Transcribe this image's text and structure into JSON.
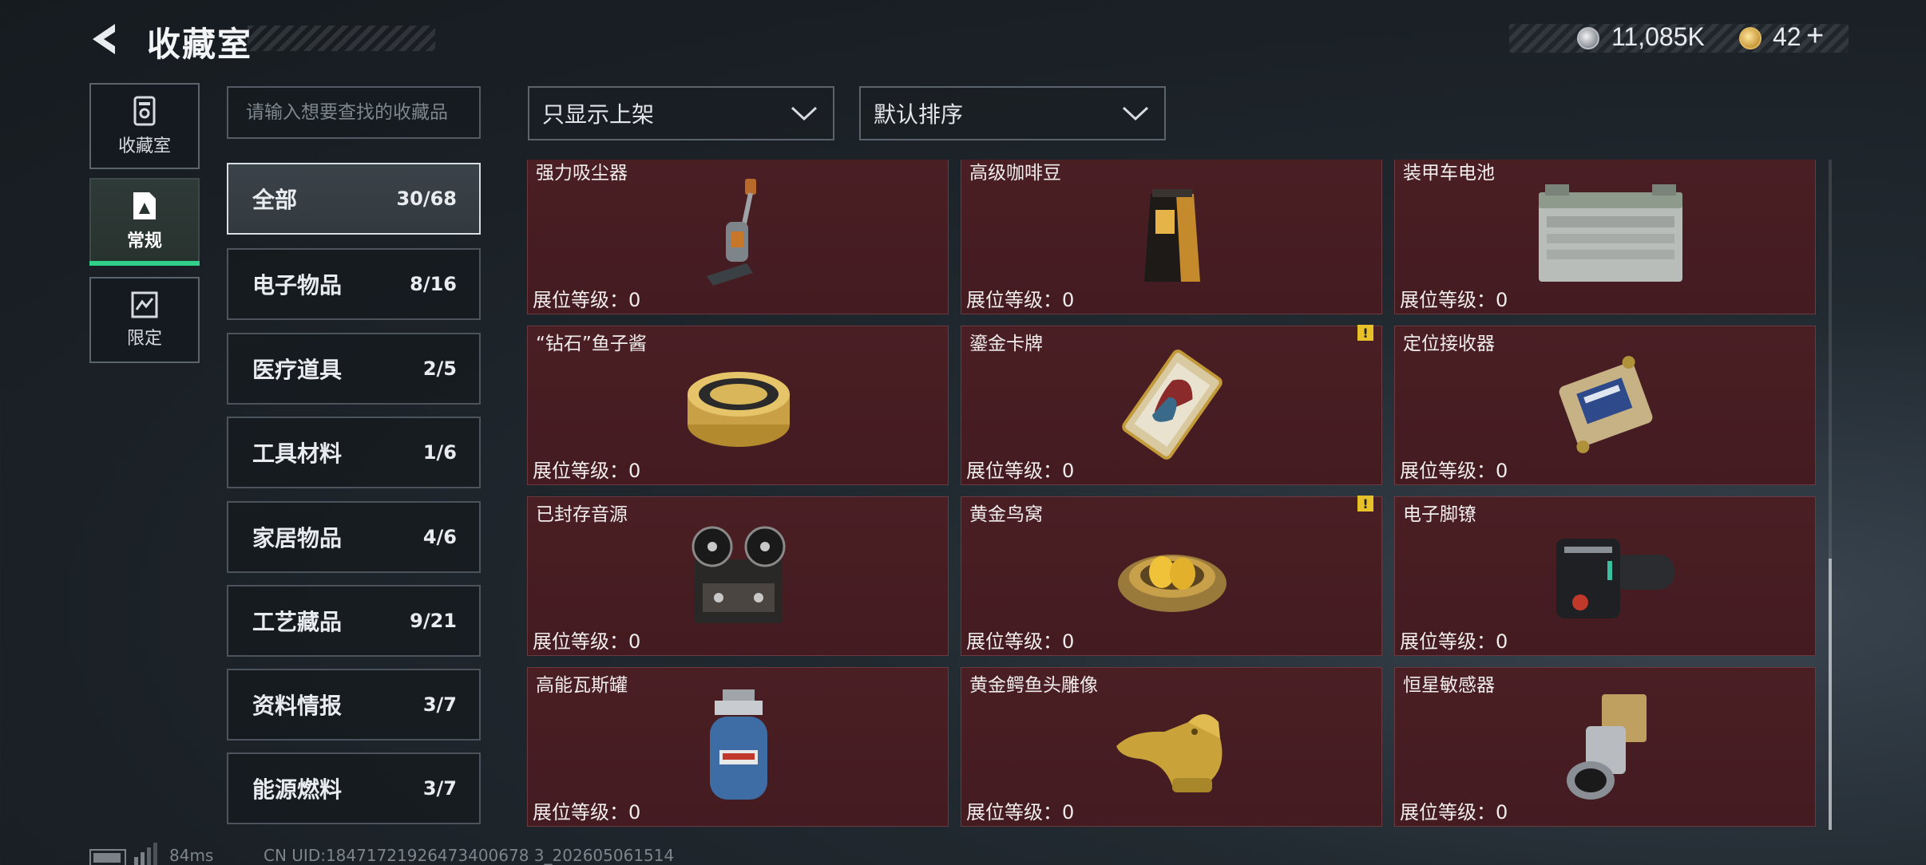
{
  "header": {
    "title": "收藏室"
  },
  "currency": {
    "silver_value": "11,085K",
    "gold_value": "42",
    "add_label": "+"
  },
  "nav": {
    "items": [
      {
        "label": "收藏室",
        "icon": "collection-icon",
        "active": false
      },
      {
        "label": "常规",
        "icon": "regular-icon",
        "active": true
      },
      {
        "label": "限定",
        "icon": "limited-icon",
        "active": false
      }
    ]
  },
  "search": {
    "placeholder": "请输入想要查找的收藏品",
    "value": ""
  },
  "filters": {
    "display_filter": {
      "selected": "只显示上架"
    },
    "sort": {
      "selected": "默认排序"
    }
  },
  "categories": [
    {
      "name": "全部",
      "count": "30/68",
      "active": true
    },
    {
      "name": "电子物品",
      "count": "8/16"
    },
    {
      "name": "医疗道具",
      "count": "2/5"
    },
    {
      "name": "工具材料",
      "count": "1/6"
    },
    {
      "name": "家居物品",
      "count": "4/6"
    },
    {
      "name": "工艺藏品",
      "count": "9/21"
    },
    {
      "name": "资料情报",
      "count": "3/7"
    },
    {
      "name": "能源燃料",
      "count": "3/7"
    }
  ],
  "items": [
    {
      "name": "强力吸尘器",
      "level_label": "展位等级：0",
      "icon": "vacuum-cleaner-icon",
      "warning": false
    },
    {
      "name": "高级咖啡豆",
      "level_label": "展位等级：0",
      "icon": "coffee-bag-icon",
      "warning": false
    },
    {
      "name": "装甲车电池",
      "level_label": "展位等级：0",
      "icon": "car-battery-icon",
      "warning": false
    },
    {
      "name": "“钻石”鱼子酱",
      "level_label": "展位等级：0",
      "icon": "caviar-tin-icon",
      "warning": false
    },
    {
      "name": "鎏金卡牌",
      "level_label": "展位等级：0",
      "icon": "gilded-card-icon",
      "warning": true
    },
    {
      "name": "定位接收器",
      "level_label": "展位等级：0",
      "icon": "gps-receiver-icon",
      "warning": false
    },
    {
      "name": "已封存音源",
      "level_label": "展位等级：0",
      "icon": "reel-recorder-icon",
      "warning": false
    },
    {
      "name": "黄金鸟窝",
      "level_label": "展位等级：0",
      "icon": "golden-nest-icon",
      "warning": true
    },
    {
      "name": "电子脚镣",
      "level_label": "展位等级：0",
      "icon": "ankle-monitor-icon",
      "warning": false
    },
    {
      "name": "高能瓦斯罐",
      "level_label": "展位等级：0",
      "icon": "gas-canister-icon",
      "warning": false
    },
    {
      "name": "黄金鳄鱼头雕像",
      "level_label": "展位等级：0",
      "icon": "golden-crocodile-icon",
      "warning": false
    },
    {
      "name": "恒星敏感器",
      "level_label": "展位等级：0",
      "icon": "star-sensor-icon",
      "warning": false
    }
  ],
  "footer": {
    "ping": "84ms",
    "uid": "CN UID:18471721926473400678 3_202605061514"
  },
  "colors": {
    "card_bg": "#4a1f24",
    "active_accent": "#2fd08a",
    "warning": "#e6c12a"
  }
}
